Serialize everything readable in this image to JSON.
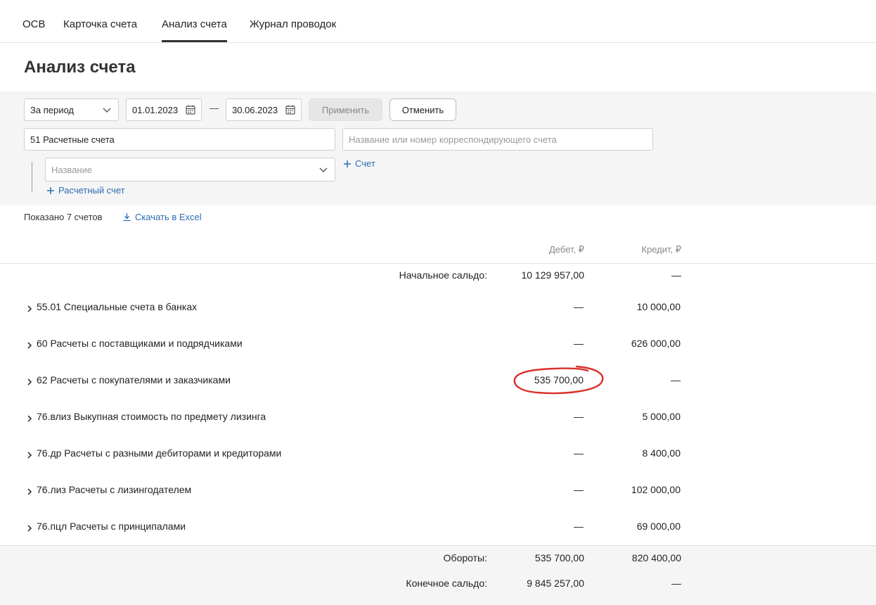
{
  "tabs": [
    {
      "label": "ОСВ",
      "active": false
    },
    {
      "label": "Карточка счета",
      "active": false
    },
    {
      "label": "Анализ счета",
      "active": true
    },
    {
      "label": "Журнал проводок",
      "active": false
    }
  ],
  "page": {
    "title": "Анализ счета"
  },
  "filters": {
    "period_select": "За период",
    "date_from": "01.01.2023",
    "date_separator": "—",
    "date_to": "30.06.2023",
    "apply_label": "Применить",
    "cancel_label": "Отменить",
    "account_value": "51 Расчетные счета",
    "corr_account_placeholder": "Название или номер корреспондирующего счета",
    "name_placeholder": "Название",
    "add_account_link": "Счет",
    "add_bank_account_link": "Расчетный счет"
  },
  "summary": {
    "shown_count": "Показано 7 счетов",
    "download_link": "Скачать в Excel"
  },
  "table": {
    "col_debit": "Дебет, ₽",
    "col_credit": "Кредит, ₽",
    "opening_label": "Начальное сальдо:",
    "opening_debit": "10 129 957,00",
    "opening_credit": "—",
    "rows": [
      {
        "name": "55.01 Специальные счета в банках",
        "debit": "—",
        "credit": "10 000,00"
      },
      {
        "name": "60 Расчеты с поставщиками и подрядчиками",
        "debit": "—",
        "credit": "626 000,00"
      },
      {
        "name": "62 Расчеты с покупателями и заказчиками",
        "debit": "535 700,00",
        "credit": "—"
      },
      {
        "name": "76.влиз Выкупная стоимость по предмету лизинга",
        "debit": "—",
        "credit": "5 000,00"
      },
      {
        "name": "76.др Расчеты с разными дебиторами и кредиторами",
        "debit": "—",
        "credit": "8 400,00"
      },
      {
        "name": "76.лиз Расчеты с лизингодателем",
        "debit": "—",
        "credit": "102 000,00"
      },
      {
        "name": "76.пцл Расчеты с принципалами",
        "debit": "—",
        "credit": "69 000,00"
      }
    ],
    "turnover_label": "Обороты:",
    "turnover_debit": "535 700,00",
    "turnover_credit": "820 400,00",
    "closing_label": "Конечное сальдо:",
    "closing_debit": "9 845 257,00",
    "closing_credit": "—"
  },
  "colors": {
    "link": "#2a6db5",
    "annotation": "#d9322b",
    "panel_bg": "#f5f5f5"
  }
}
